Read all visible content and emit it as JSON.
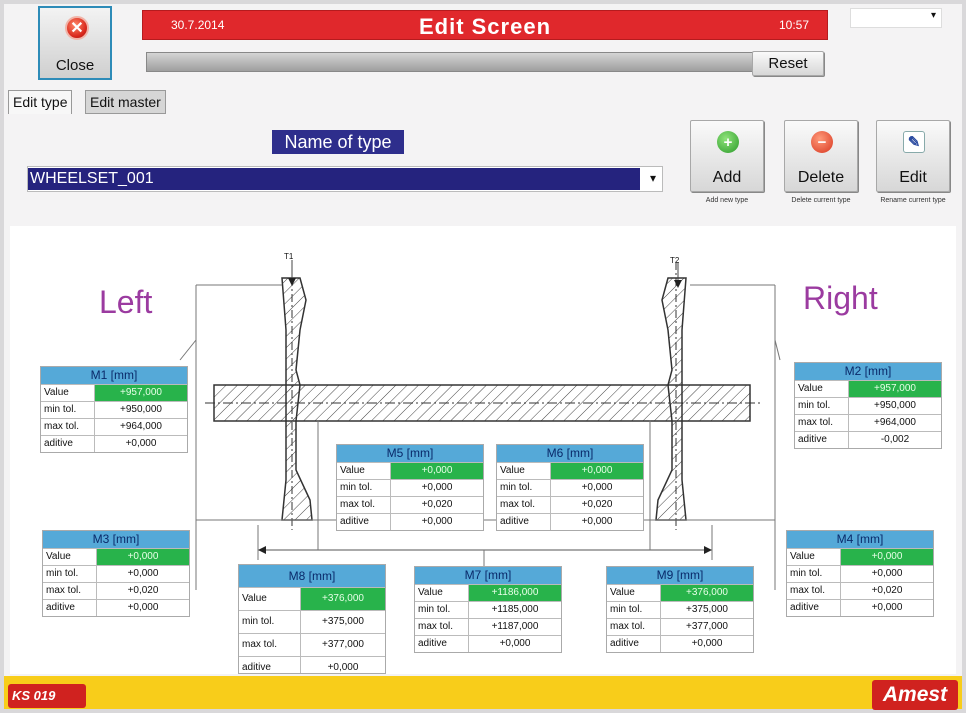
{
  "header": {
    "date": "30.7.2014",
    "title": "Edit Screen",
    "time": "10:57",
    "close_label": "Close",
    "reset_label": "Reset"
  },
  "tabs": [
    {
      "label": "Edit type"
    },
    {
      "label": "Edit master"
    }
  ],
  "type": {
    "name_label": "Name of type",
    "selected": "WHEELSET_001"
  },
  "actions": [
    {
      "label": "Add",
      "sub": "Add new type"
    },
    {
      "label": "Delete",
      "sub": "Delete current type"
    },
    {
      "label": "Edit",
      "sub": "Rename current type"
    }
  ],
  "diagram": {
    "left": "Left",
    "right": "Right",
    "t1": "T1",
    "t2": "T2"
  },
  "row_labels": {
    "value": "Value",
    "min": "min tol.",
    "max": "max tol.",
    "add": "aditive"
  },
  "measurements": {
    "m1": {
      "title": "M1 [mm]",
      "value": "+957,000",
      "min": "+950,000",
      "max": "+964,000",
      "add": "+0,000"
    },
    "m2": {
      "title": "M2 [mm]",
      "value": "+957,000",
      "min": "+950,000",
      "max": "+964,000",
      "add": "-0,002"
    },
    "m3": {
      "title": "M3 [mm]",
      "value": "+0,000",
      "min": "+0,000",
      "max": "+0,020",
      "add": "+0,000"
    },
    "m4": {
      "title": "M4 [mm]",
      "value": "+0,000",
      "min": "+0,000",
      "max": "+0,020",
      "add": "+0,000"
    },
    "m5": {
      "title": "M5 [mm]",
      "value": "+0,000",
      "min": "+0,000",
      "max": "+0,020",
      "add": "+0,000"
    },
    "m6": {
      "title": "M6 [mm]",
      "value": "+0,000",
      "min": "+0,000",
      "max": "+0,020",
      "add": "+0,000"
    },
    "m7": {
      "title": "M7 [mm]",
      "value": "+1186,000",
      "min": "+1185,000",
      "max": "+1187,000",
      "add": "+0,000"
    },
    "m8": {
      "title": "M8 [mm]",
      "value": "+376,000",
      "min": "+375,000",
      "max": "+377,000",
      "add": "+0,000"
    },
    "m9": {
      "title": "M9 [mm]",
      "value": "+376,000",
      "min": "+375,000",
      "max": "+377,000",
      "add": "+0,000"
    }
  },
  "footer": {
    "code": "KS 019",
    "brand": "Amest"
  },
  "colors": {
    "title_red": "#e0282c",
    "value_green": "#28b34b",
    "header_blue": "#55a9d8",
    "footer_yellow": "#f8cd1a"
  }
}
